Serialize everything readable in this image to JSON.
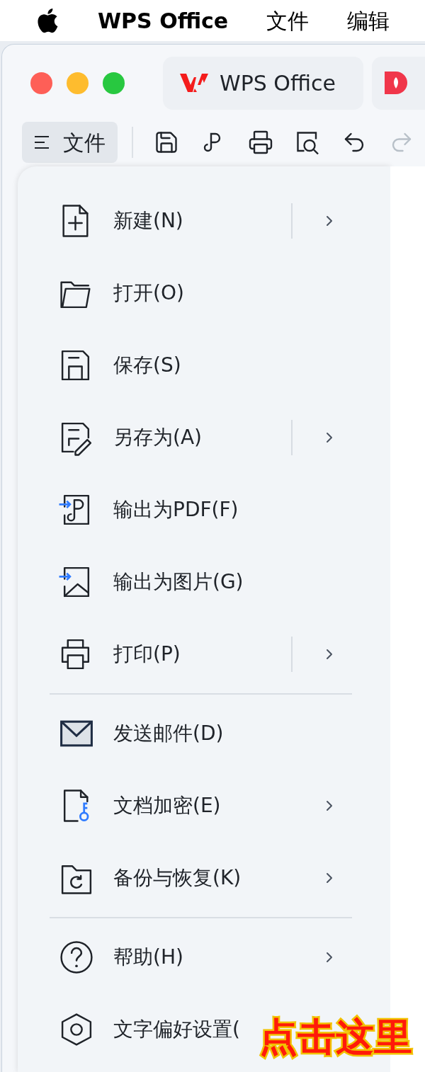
{
  "menu_bar": {
    "app_name": "WPS Office",
    "items": [
      "文件",
      "编辑"
    ]
  },
  "tabs": [
    {
      "label": "WPS Office",
      "kind": "wps"
    },
    {
      "kind": "docer"
    }
  ],
  "toolbar": {
    "file_button": {
      "label": "文件"
    },
    "tools": [
      {
        "disabled": false
      },
      {
        "disabled": false
      },
      {
        "disabled": false
      },
      {
        "disabled": false
      },
      {
        "disabled": false
      },
      {
        "disabled": true
      }
    ]
  },
  "file_menu": {
    "groups": [
      {
        "items": [
          {
            "label": "新建(N)",
            "kind": "split"
          },
          {
            "label": "打开(O)",
            "kind": "plain"
          },
          {
            "label": "保存(S)",
            "kind": "plain"
          },
          {
            "label": "另存为(A)",
            "kind": "split"
          },
          {
            "label": "输出为PDF(F)",
            "kind": "plain"
          },
          {
            "label": "输出为图片(G)",
            "kind": "plain"
          },
          {
            "label": "打印(P)",
            "kind": "split"
          }
        ]
      },
      {
        "items": [
          {
            "label": "发送邮件(D)",
            "kind": "plain"
          },
          {
            "label": "文档加密(E)",
            "kind": "submenu"
          },
          {
            "label": "备份与恢复(K)",
            "kind": "submenu"
          }
        ]
      },
      {
        "items": [
          {
            "label": "帮助(H)",
            "kind": "submenu"
          },
          {
            "label": "文字偏好设置(",
            "kind": "plain"
          }
        ]
      }
    ]
  },
  "callout": {
    "text": "点击这里"
  }
}
